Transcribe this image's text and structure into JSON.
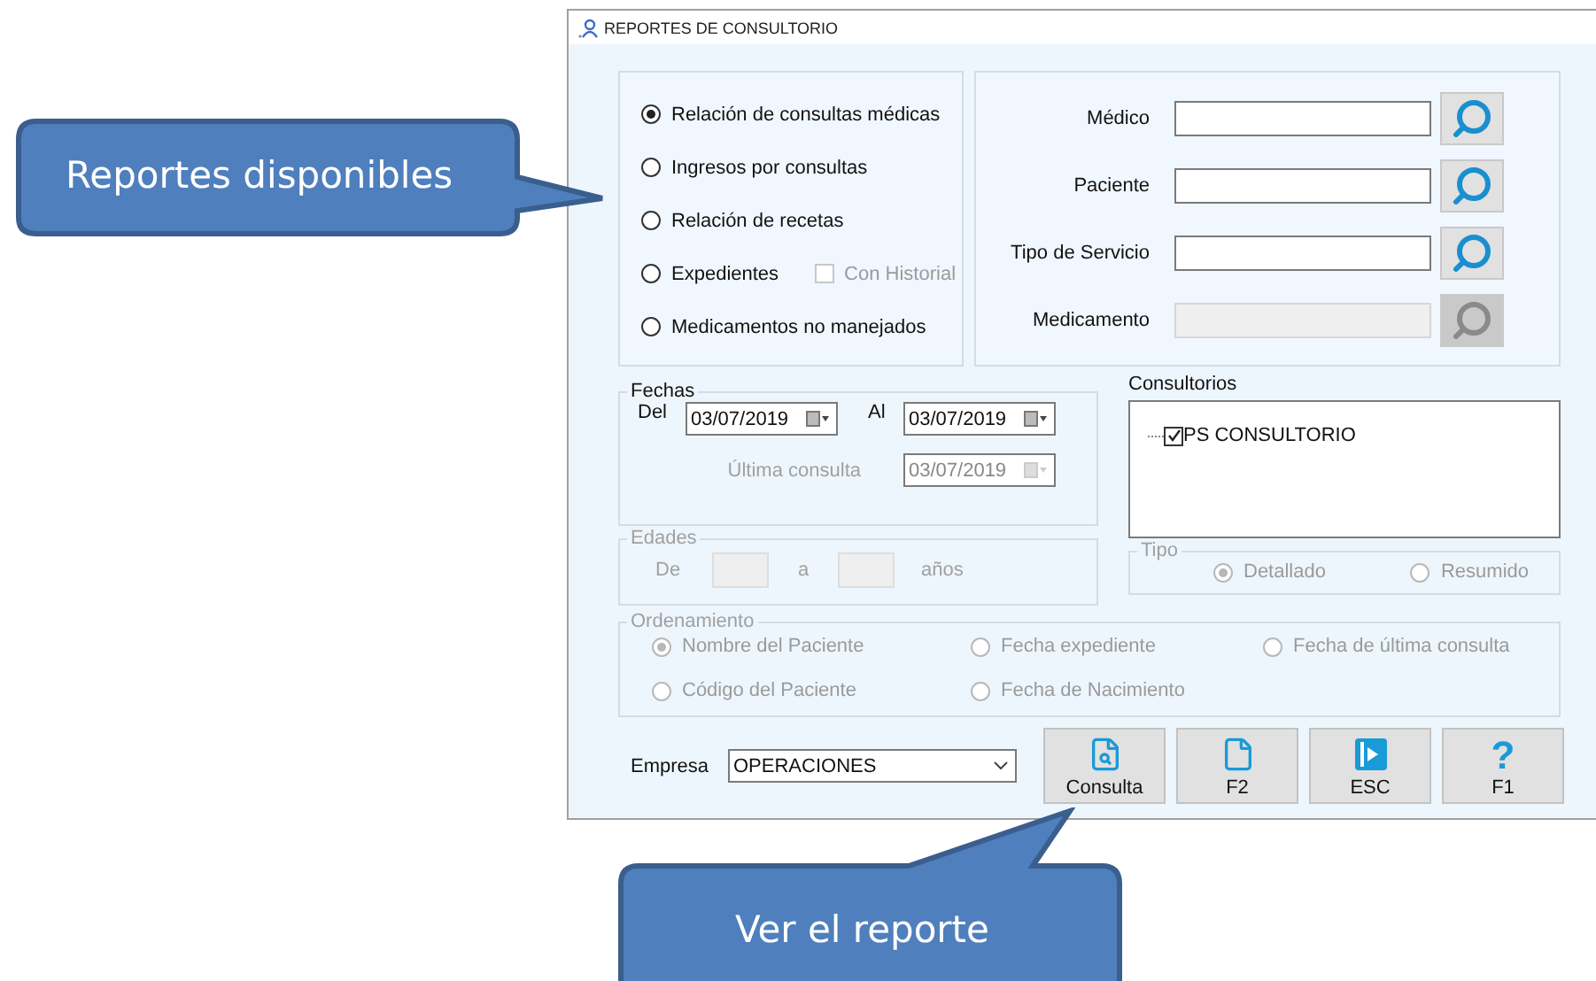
{
  "window": {
    "title": "REPORTES DE CONSULTORIO"
  },
  "report_types": [
    {
      "label": "Relación de consultas médicas",
      "selected": true
    },
    {
      "label": "Ingresos por consultas",
      "selected": false
    },
    {
      "label": "Relación de recetas",
      "selected": false
    },
    {
      "label": "Expedientes",
      "selected": false
    },
    {
      "label": "Medicamentos no manejados",
      "selected": false
    }
  ],
  "con_historial": {
    "label": "Con Historial",
    "checked": false,
    "disabled": true
  },
  "filters": [
    {
      "label": "Médico",
      "disabled": false
    },
    {
      "label": "Paciente",
      "disabled": false
    },
    {
      "label": "Tipo de Servicio",
      "disabled": false
    },
    {
      "label": "Medicamento",
      "disabled": true
    }
  ],
  "fechas": {
    "title": "Fechas",
    "from_label": "Del",
    "from": "03/07/2019",
    "to_label": "Al",
    "to": "03/07/2019",
    "last_label": "Última consulta",
    "last": "03/07/2019",
    "last_disabled": true
  },
  "edades": {
    "title": "Edades",
    "from_label": "De",
    "to_label": "a",
    "unit": "años",
    "disabled": true
  },
  "consultorios": {
    "title": "Consultorios",
    "items": [
      {
        "label": "PS CONSULTORIO",
        "checked": true
      }
    ]
  },
  "tipo": {
    "title": "Tipo",
    "disabled": true,
    "options": [
      {
        "label": "Detallado",
        "selected": true
      },
      {
        "label": "Resumido",
        "selected": false
      }
    ]
  },
  "ordenamiento": {
    "title": "Ordenamiento",
    "disabled": true,
    "options": [
      {
        "label": "Nombre del Paciente",
        "selected": true
      },
      {
        "label": "Fecha expediente",
        "selected": false
      },
      {
        "label": "Fecha de última consulta",
        "selected": false
      },
      {
        "label": "Código del Paciente",
        "selected": false
      },
      {
        "label": "Fecha de Nacimiento",
        "selected": false
      }
    ]
  },
  "empresa": {
    "label": "Empresa",
    "value": "OPERACIONES"
  },
  "buttons": [
    {
      "label": "Consulta",
      "kind": "consulta"
    },
    {
      "label": "F2",
      "kind": "new"
    },
    {
      "label": "ESC",
      "kind": "exit"
    },
    {
      "label": "F1",
      "kind": "help",
      "symbol": "?"
    }
  ],
  "callouts": [
    {
      "text": "Reportes disponibles"
    },
    {
      "text": "Ver el reporte"
    }
  ]
}
